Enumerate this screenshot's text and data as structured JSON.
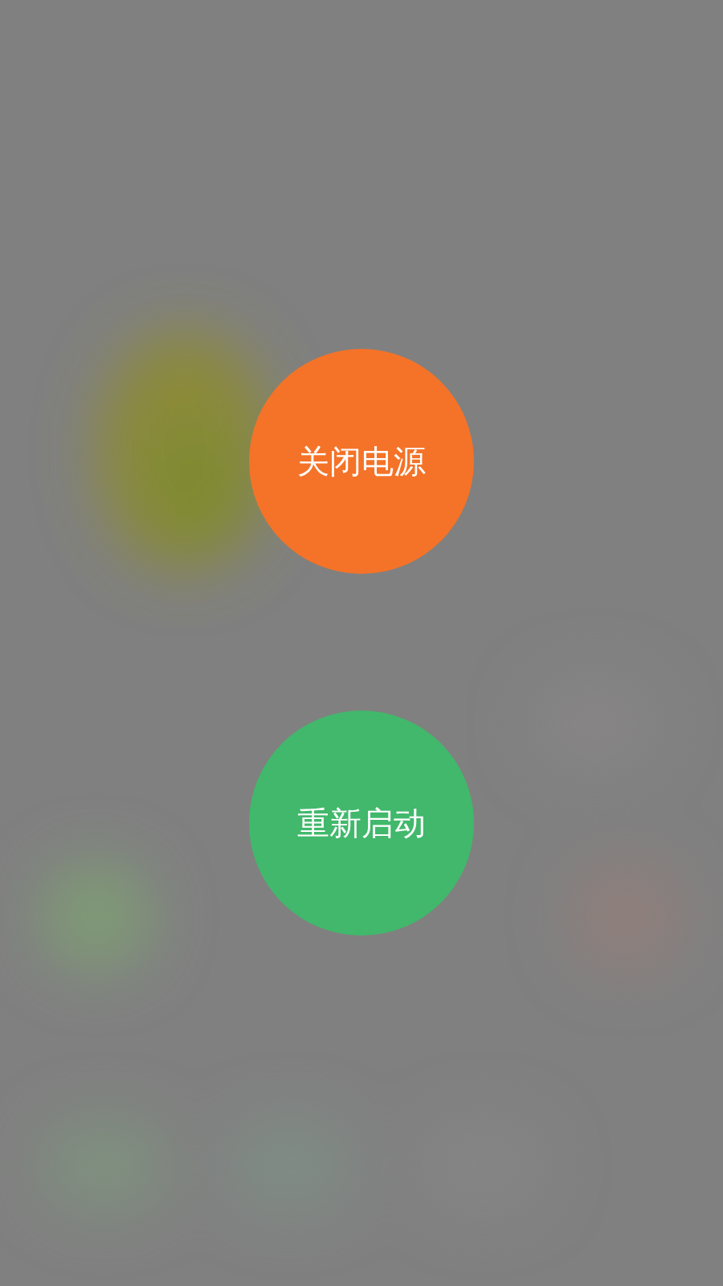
{
  "buttons": [
    {
      "label": "关闭电源",
      "color": "#f47328"
    },
    {
      "label": "重新启动",
      "color": "#41b86b"
    }
  ]
}
